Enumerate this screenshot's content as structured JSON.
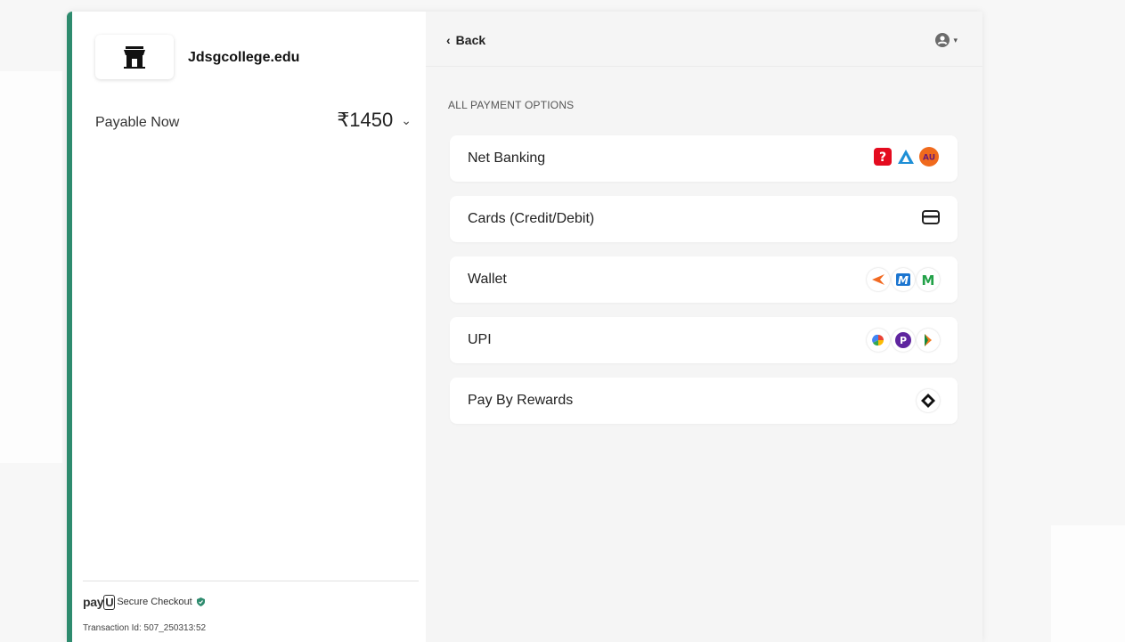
{
  "merchant": {
    "name": "Jdsgcollege.edu",
    "logo_icon": "store-icon"
  },
  "payment": {
    "label": "Payable Now",
    "amount": "₹1450",
    "chevron": "⌄"
  },
  "footer": {
    "brand": "payU",
    "secure_text": "Secure Checkout",
    "transaction": "Transaction Id: 507_250313:52"
  },
  "header": {
    "back_label": "Back",
    "user_icon": "user-icon"
  },
  "section_title": "ALL PAYMENT OPTIONS",
  "options": [
    {
      "label": "Net Banking",
      "icons": [
        "airtel-bank-icon",
        "bajaj-icon",
        "au-bank-icon"
      ]
    },
    {
      "label": "Cards (Credit/Debit)",
      "icons": [
        "card-icon"
      ]
    },
    {
      "label": "Wallet",
      "icons": [
        "freecharge-icon",
        "mobikwik-icon",
        "m-wallet-icon"
      ]
    },
    {
      "label": "UPI",
      "icons": [
        "gpay-icon",
        "phonepe-icon",
        "bhim-icon"
      ]
    },
    {
      "label": "Pay By Rewards",
      "icons": [
        "rewards-icon"
      ]
    }
  ],
  "colors": {
    "accent": "#2e8b6e",
    "panel_bg": "#f5f5f5"
  }
}
